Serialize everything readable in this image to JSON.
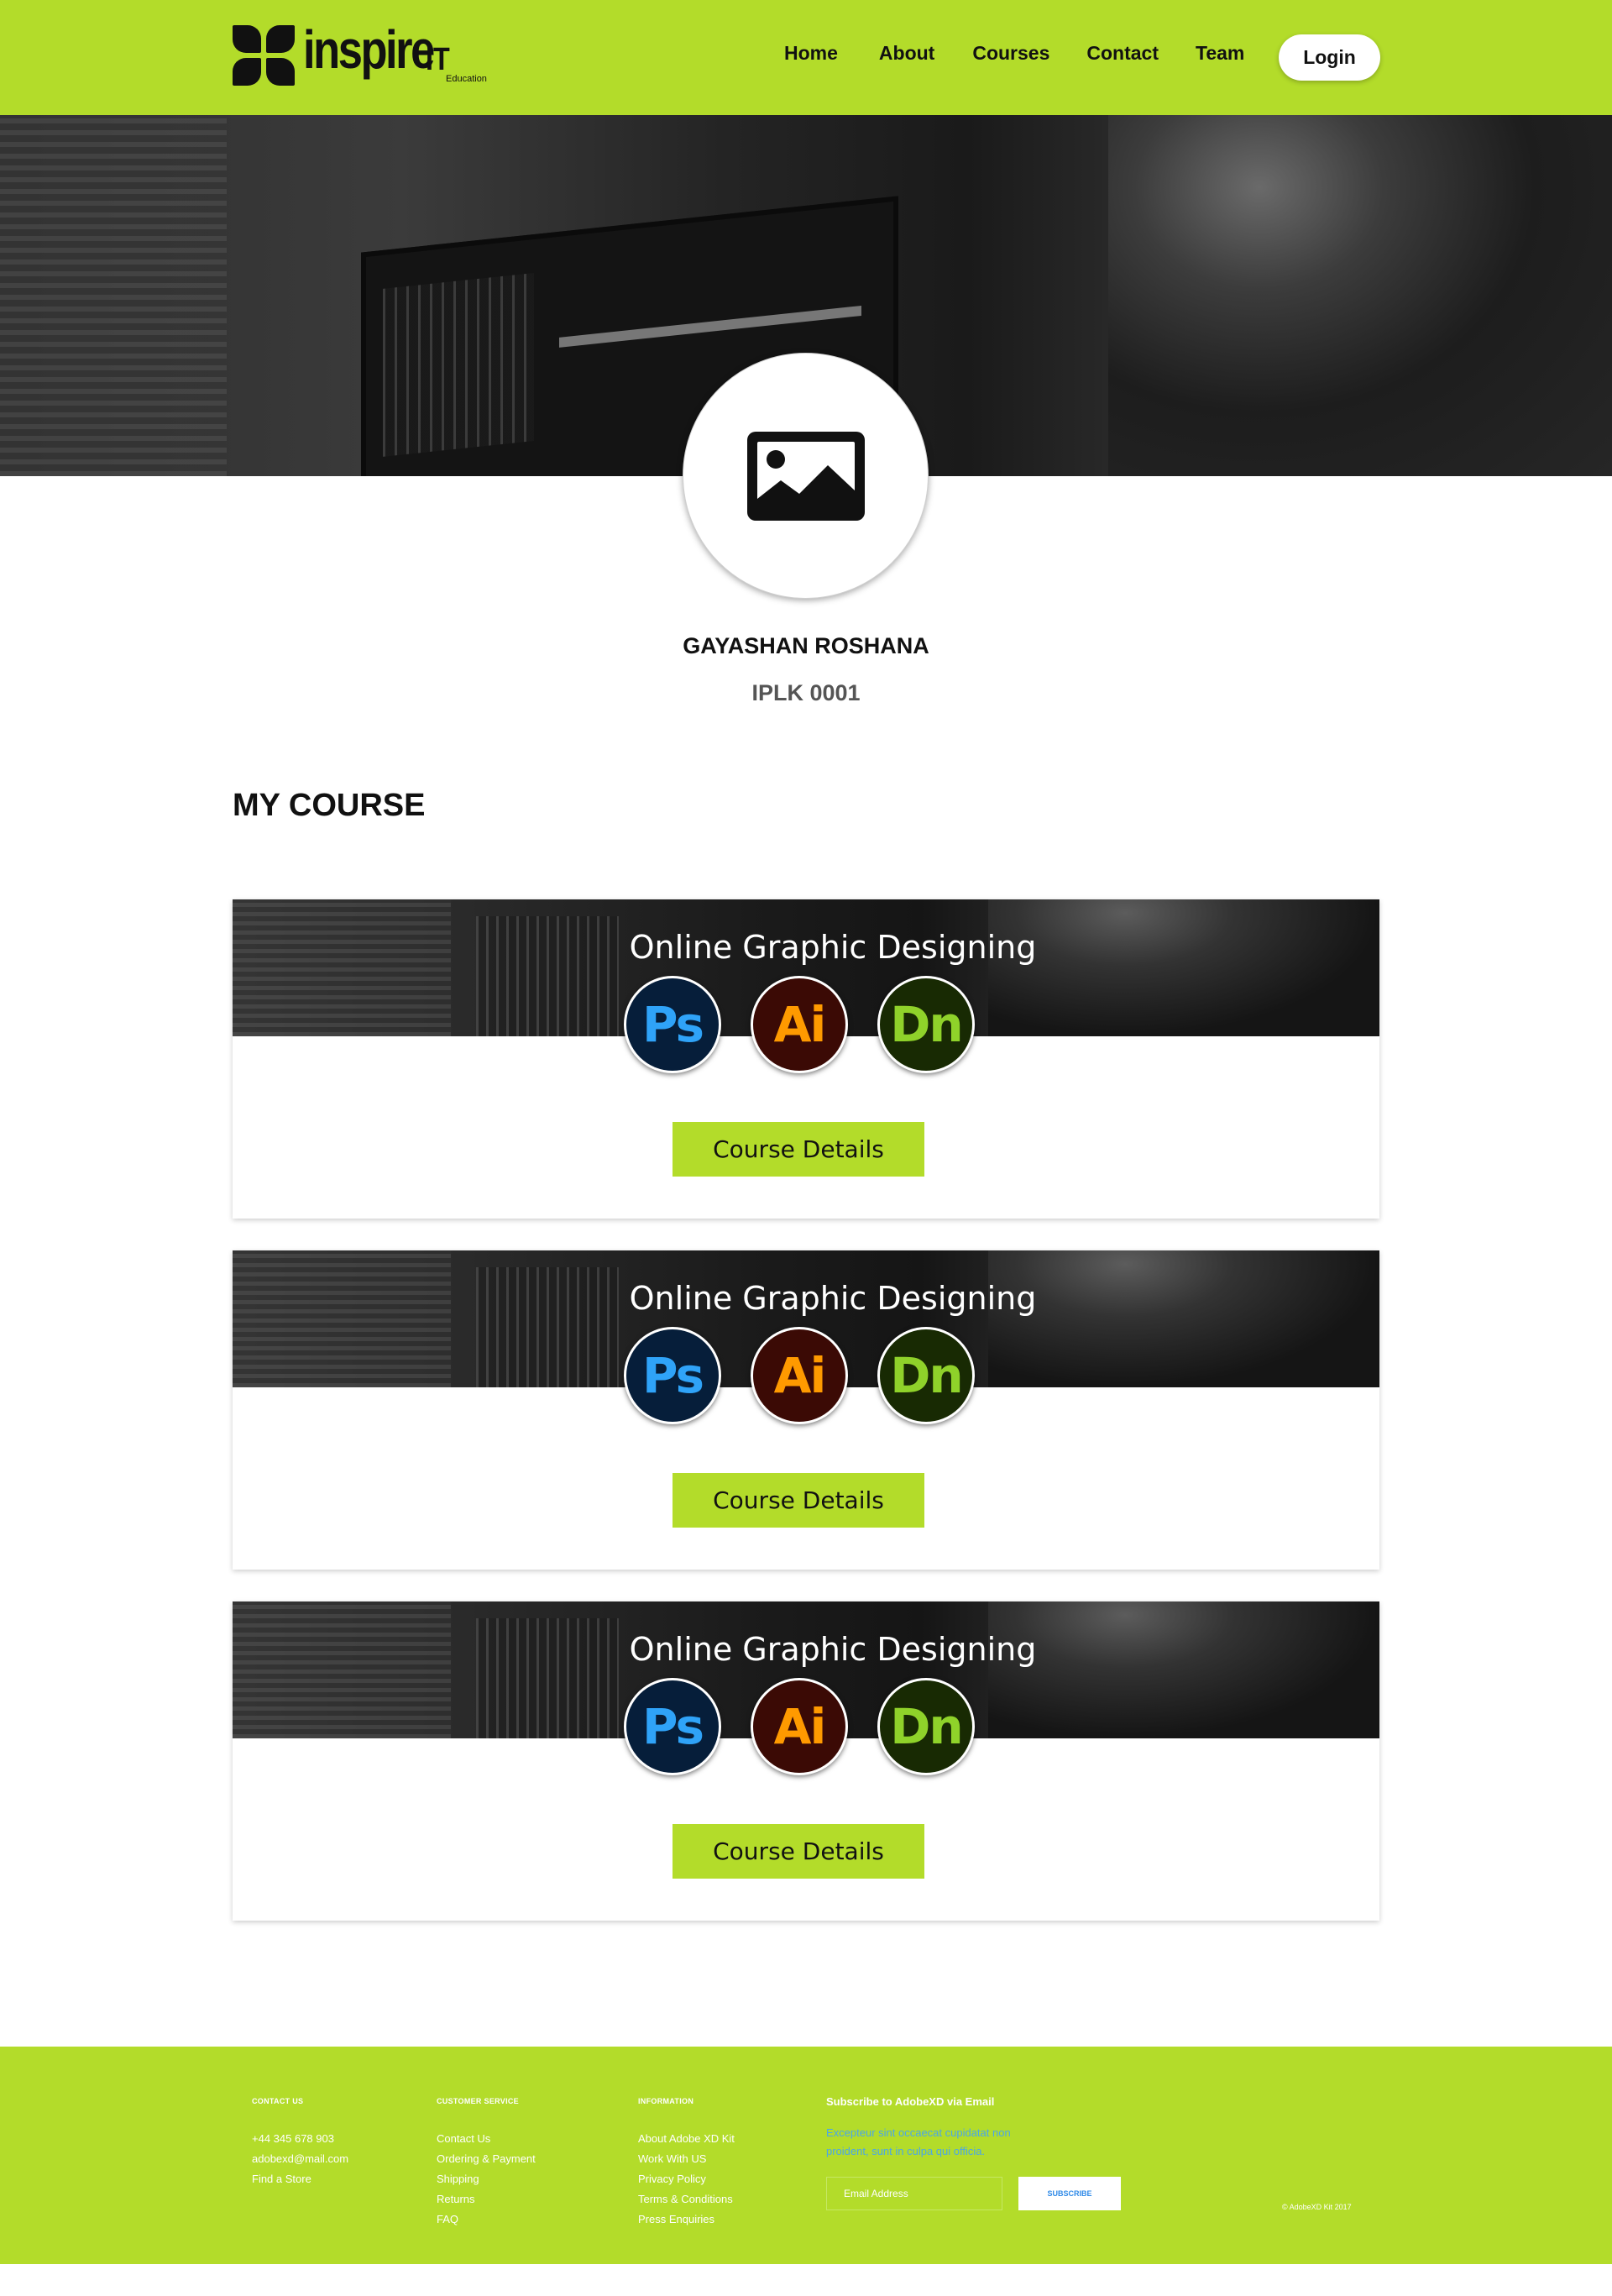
{
  "brand": {
    "name": "inspire",
    "suffix": "IT",
    "tagline": "Education"
  },
  "nav": {
    "items": [
      {
        "label": "Home"
      },
      {
        "label": "About"
      },
      {
        "label": "Courses"
      },
      {
        "label": "Contact"
      },
      {
        "label": "Team"
      }
    ],
    "login_label": "Login"
  },
  "profile": {
    "name": "GAYASHAN ROSHANA",
    "id": "IPLK 0001",
    "avatar_icon": "image-icon"
  },
  "section_title": "MY COURSE",
  "courses": [
    {
      "title": "Online Graphic Designing",
      "apps": [
        "Ps",
        "Ai",
        "Dn"
      ],
      "button": "Course Details"
    },
    {
      "title": "Online Graphic Designing",
      "apps": [
        "Ps",
        "Ai",
        "Dn"
      ],
      "button": "Course Details"
    },
    {
      "title": "Online Graphic Designing",
      "apps": [
        "Ps",
        "Ai",
        "Dn"
      ],
      "button": "Course Details"
    }
  ],
  "footer": {
    "contact": {
      "heading": "CONTACT US",
      "items": [
        "+44 345 678 903",
        "adobexd@mail.com",
        "Find a Store"
      ]
    },
    "service": {
      "heading": "CUSTOMER SERVICE",
      "items": [
        "Contact Us",
        "Ordering & Payment",
        "Shipping",
        "Returns",
        "FAQ"
      ]
    },
    "info": {
      "heading": "INFORMATION",
      "items": [
        "About Adobe XD Kit",
        "Work With US",
        "Privacy Policy",
        "Terms & Conditions",
        "Press Enquiries"
      ]
    },
    "subscribe": {
      "heading": "Subscribe to AdobeXD via Email",
      "text": "Excepteur sint occaecat cupidatat non proident, sunt in culpa qui officia.",
      "placeholder": "Email Address",
      "button": "SUBSCRIBE"
    },
    "copyright": "© AdobeXD Kit 2017"
  },
  "colors": {
    "accent": "#b3dc2a",
    "ps": "#2fa3f8",
    "ai": "#ff9a00",
    "dn": "#8fd22a",
    "link": "#4aa6e8"
  }
}
